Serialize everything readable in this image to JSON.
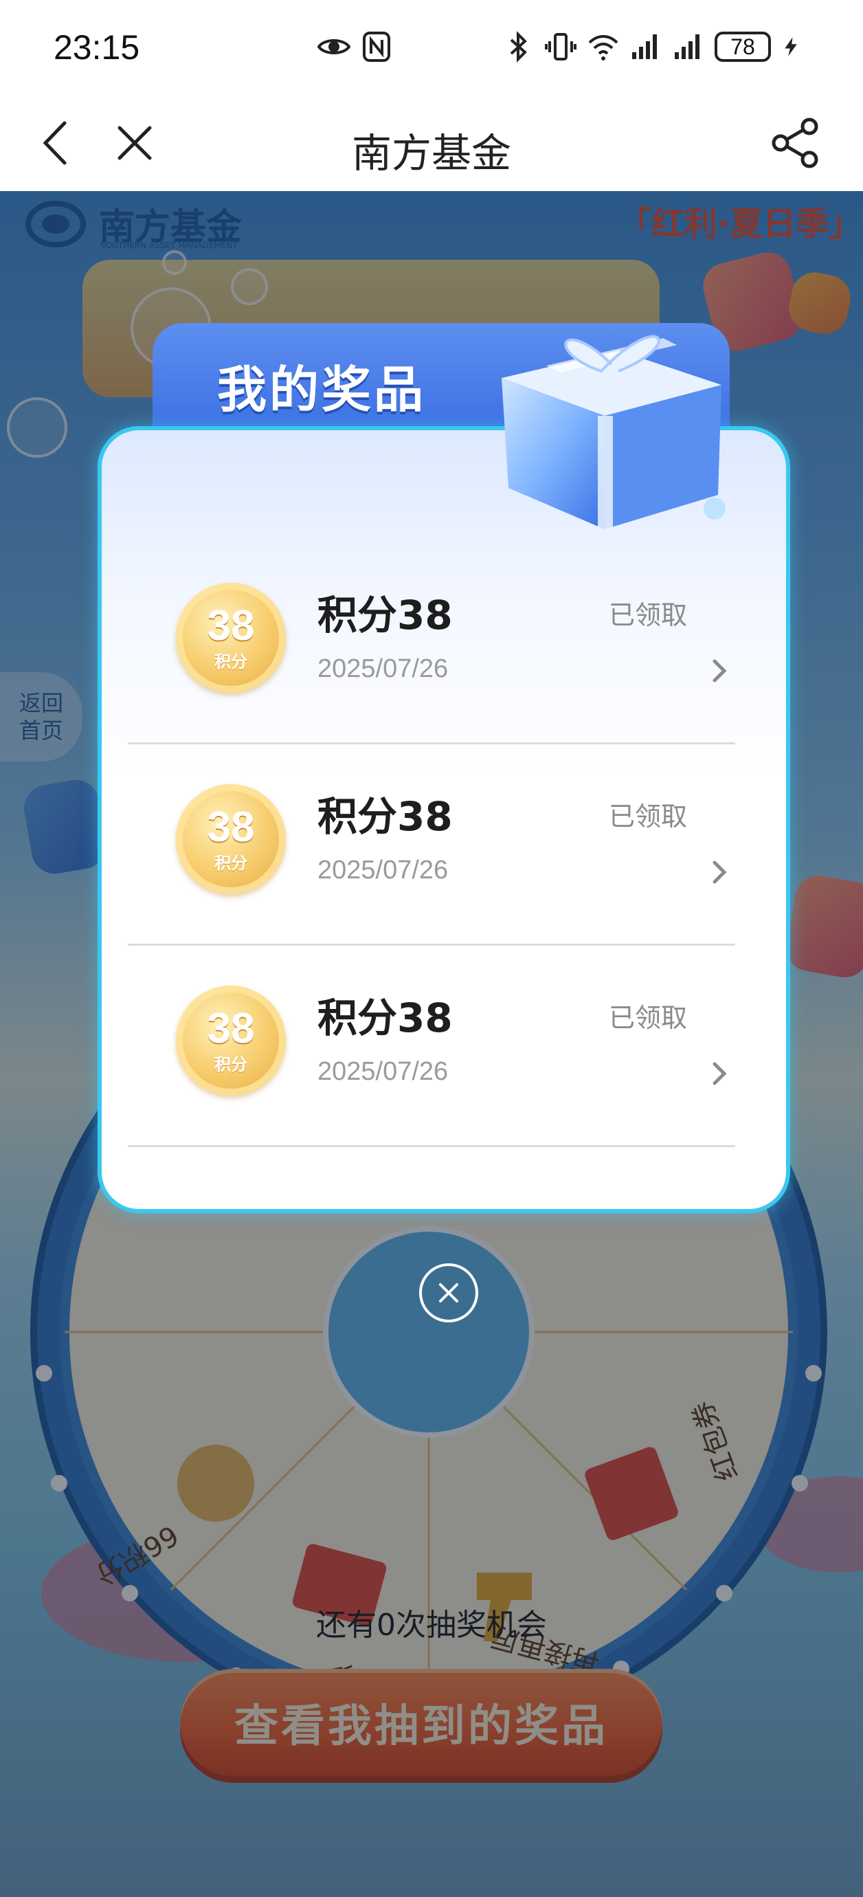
{
  "status_bar": {
    "time": "23:15",
    "battery": "78",
    "icons": [
      "eye-icon",
      "nfc-icon",
      "bluetooth-icon",
      "vibrate-icon",
      "wifi-icon",
      "signal-icon",
      "signal-icon",
      "charging-icon"
    ]
  },
  "nav": {
    "title": "南方基金",
    "back_icon": "chevron-left-icon",
    "close_icon": "close-icon",
    "share_icon": "share-icon"
  },
  "background": {
    "brand_name": "南方基金",
    "brand_sub": "SOUTHERN ASSET MANAGEMENT",
    "season_tag": "「红利·夏日季」",
    "return_home": [
      "返回",
      "首页"
    ],
    "wheel_segments": [
      "66积分",
      "红包券",
      "再接再厉",
      "红包券"
    ],
    "chances_text": "还有0次抽奖机会",
    "view_prizes_button": "查看我抽到的奖品"
  },
  "modal": {
    "title": "我的奖品",
    "prizes": [
      {
        "coin_value": "38",
        "coin_unit": "积分",
        "name": "积分38",
        "date": "2025/07/26",
        "status": "已领取"
      },
      {
        "coin_value": "38",
        "coin_unit": "积分",
        "name": "积分38",
        "date": "2025/07/26",
        "status": "已领取"
      },
      {
        "coin_value": "38",
        "coin_unit": "积分",
        "name": "积分38",
        "date": "2025/07/26",
        "status": "已领取"
      }
    ]
  },
  "colors": {
    "accent_blue": "#3568de",
    "modal_border": "#3cc7f0",
    "button_orange": "#f25f2c",
    "coin_gold": "#f7cd6e"
  }
}
